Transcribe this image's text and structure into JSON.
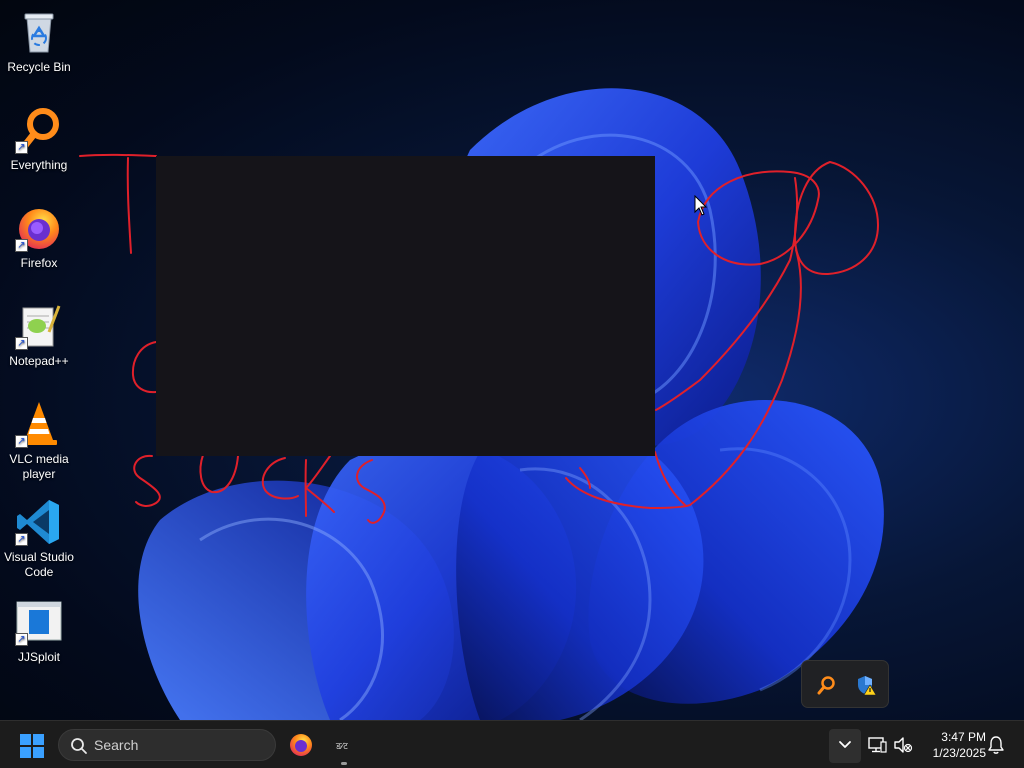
{
  "desktop": {
    "icons": [
      {
        "label": "Recycle Bin",
        "icon": "recycle-bin-icon"
      },
      {
        "label": "Everything",
        "icon": "everything-search-icon"
      },
      {
        "label": "Firefox",
        "icon": "firefox-icon"
      },
      {
        "label": "Notepad++",
        "icon": "notepad-plus-plus-icon"
      },
      {
        "label": "VLC media player",
        "icon": "vlc-icon"
      },
      {
        "label": "Visual Studio Code",
        "icon": "vscode-icon"
      },
      {
        "label": "JJSploit",
        "icon": "jjsploit-icon"
      }
    ]
  },
  "taskbar": {
    "search_label": "Search",
    "apps": [
      {
        "name": "Firefox",
        "icon": "firefox-icon"
      },
      {
        "name": "JJSploit",
        "icon": "jjsploit-icon"
      }
    ],
    "tray": {
      "time": "3:47 PM",
      "date": "1/23/2025"
    }
  },
  "tray_flyout": {
    "icons": [
      "everything-search-icon",
      "security-warning-icon"
    ]
  },
  "colors": {
    "annotation_red": "#e0202a",
    "taskbar_bg": "#1c1c1c",
    "redaction": "#151419"
  }
}
